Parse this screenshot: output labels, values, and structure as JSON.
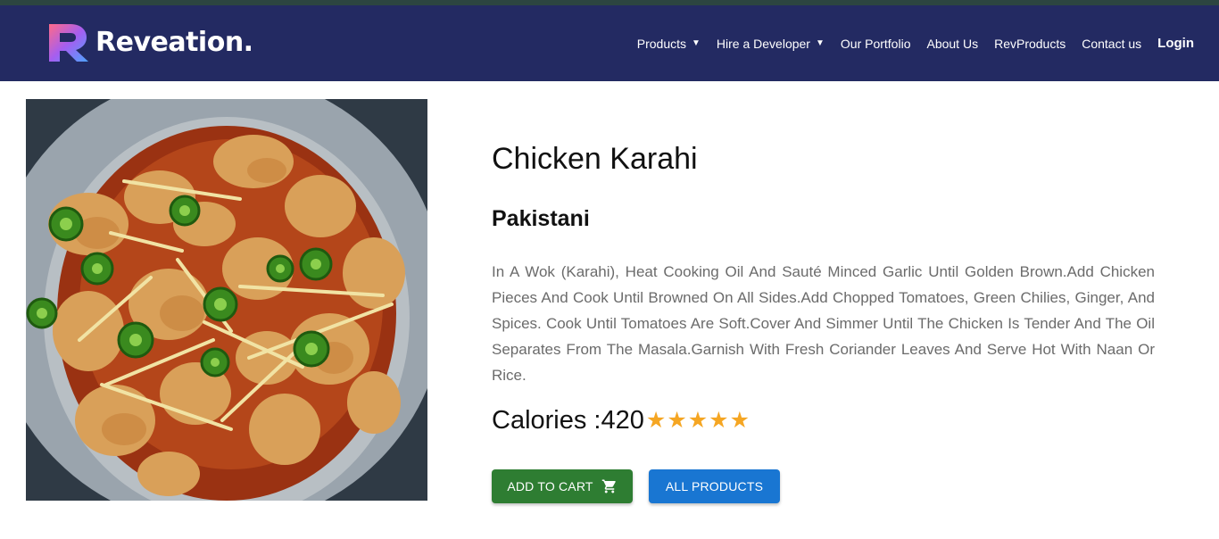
{
  "brand": {
    "name": "Reveation."
  },
  "nav": {
    "items": [
      {
        "label": "Products",
        "dropdown": true
      },
      {
        "label": "Hire a Developer",
        "dropdown": true
      },
      {
        "label": "Our Portfolio",
        "dropdown": false
      },
      {
        "label": "About Us",
        "dropdown": false
      },
      {
        "label": "RevProducts",
        "dropdown": false
      },
      {
        "label": "Contact us",
        "dropdown": false
      }
    ],
    "login": "Login"
  },
  "product": {
    "title": "Chicken Karahi",
    "cuisine": "Pakistani",
    "description": "In A Wok (Karahi), Heat Cooking Oil And Sauté Minced Garlic Until Golden Brown.Add Chicken Pieces And Cook Until Browned On All Sides.Add Chopped Tomatoes, Green Chilies, Ginger, And Spices. Cook Until Tomatoes Are Soft.Cover And Simmer Until The Chicken Is Tender And The Oil Separates From The Masala.Garnish With Fresh Coriander Leaves And Serve Hot With Naan Or Rice.",
    "calories_label": "Calories : ",
    "calories_value": "420",
    "rating": 5,
    "rating_max": 5
  },
  "buttons": {
    "add_to_cart": "ADD TO CART",
    "all_products": "ALL PRODUCTS"
  },
  "icons": {
    "cart": "shopping-cart-icon",
    "star": "star-icon",
    "caret": "caret-down-icon"
  },
  "colors": {
    "navbar": "#232a62",
    "star": "#f5a623",
    "add_to_cart": "#2e7d32",
    "all_products": "#1976d2",
    "description_text": "#6b6b6b"
  }
}
